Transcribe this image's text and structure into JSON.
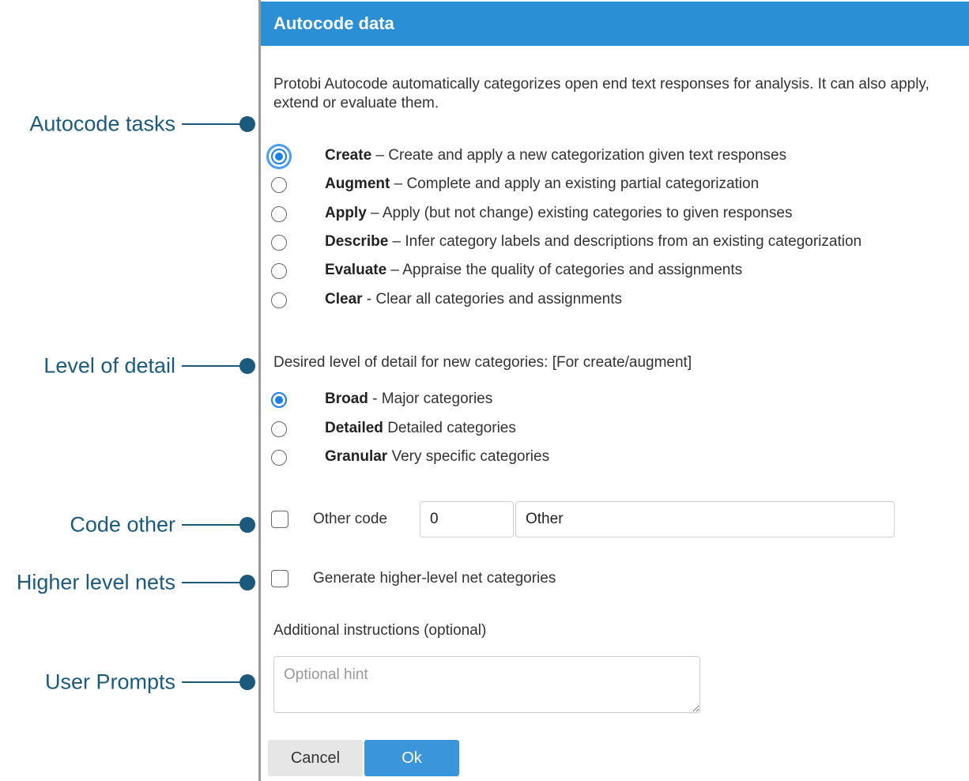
{
  "callouts": [
    {
      "label": "Autocode tasks"
    },
    {
      "label": "Level of detail"
    },
    {
      "label": "Code other"
    },
    {
      "label": "Higher level nets"
    },
    {
      "label": "User Prompts"
    }
  ],
  "dialog": {
    "title": "Autocode data",
    "intro": "Protobi Autocode automatically categorizes open end text responses for analysis. It can also apply, extend or evaluate them.",
    "tasks": [
      {
        "name": "Create",
        "sep": " – ",
        "desc": "Create and apply a new categorization given text responses",
        "checked": true
      },
      {
        "name": "Augment",
        "sep": " – ",
        "desc": "Complete and apply an existing partial categorization",
        "checked": false
      },
      {
        "name": "Apply",
        "sep": " – ",
        "desc": "Apply (but not change) existing categories to given responses",
        "checked": false
      },
      {
        "name": "Describe",
        "sep": " – ",
        "desc": "Infer category labels and descriptions from an existing categorization",
        "checked": false
      },
      {
        "name": "Evaluate",
        "sep": " – ",
        "desc": "Appraise the quality of categories and assignments",
        "checked": false
      },
      {
        "name": "Clear",
        "sep": " - ",
        "desc": "Clear all categories and assignments",
        "checked": false
      }
    ],
    "detail_label": "Desired level of detail for new categories: [For create/augment]",
    "detail_options": [
      {
        "name": "Broad",
        "sep": " - ",
        "desc": "Major categories",
        "checked": true
      },
      {
        "name": "Detailed",
        "sep": " ",
        "desc": "Detailed categories",
        "checked": false
      },
      {
        "name": "Granular",
        "sep": " ",
        "desc": "Very specific categories",
        "checked": false
      }
    ],
    "other_code": {
      "label": "Other code",
      "code_value": "0",
      "name_value": "Other",
      "checked": false
    },
    "nets": {
      "label": "Generate higher-level net categories",
      "checked": false
    },
    "instructions": {
      "label": "Additional instructions (optional)",
      "placeholder": "Optional hint"
    },
    "buttons": {
      "cancel": "Cancel",
      "ok": "Ok"
    },
    "colors": {
      "titlebar": "#2b8fd6",
      "accent": "#1a7fe8",
      "callout": "#1c5a7d",
      "ok_button": "#3b95db"
    }
  }
}
